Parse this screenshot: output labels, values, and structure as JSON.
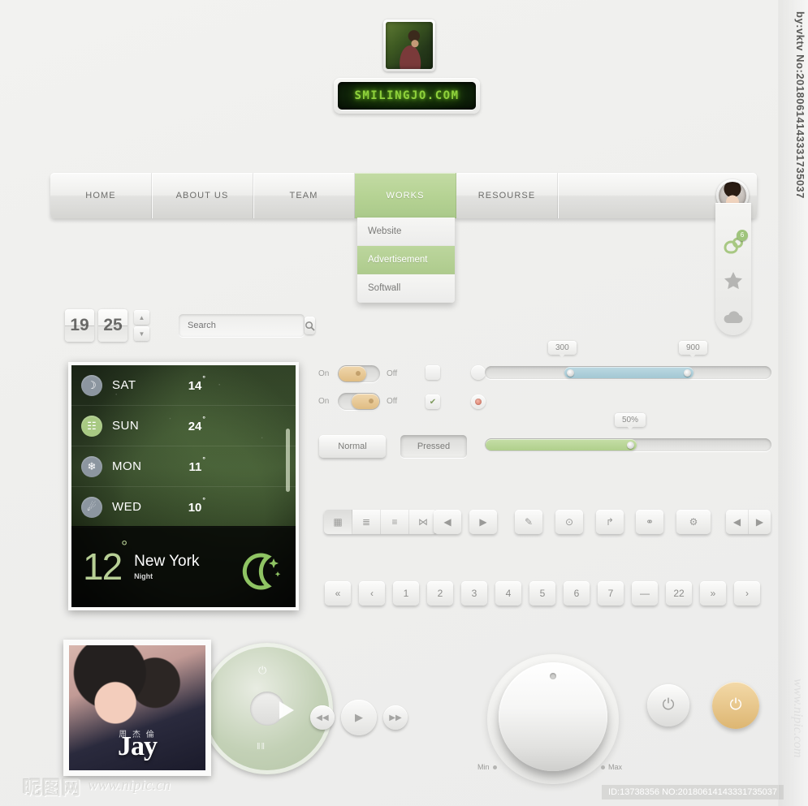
{
  "brand": {
    "led_text": "SMILINGJO.COM"
  },
  "nav": {
    "items": [
      {
        "label": "HOME",
        "active": false
      },
      {
        "label": "ABOUT US",
        "active": false
      },
      {
        "label": "TEAM",
        "active": false
      },
      {
        "label": "WORKS",
        "active": true
      },
      {
        "label": "RESOURSE",
        "active": false
      }
    ],
    "dropdown": [
      {
        "label": "Website",
        "active": false
      },
      {
        "label": "Advertisement",
        "active": true
      },
      {
        "label": "Softwall",
        "active": false
      }
    ]
  },
  "rail": {
    "items": [
      {
        "icon": "users-icon",
        "badge": "6"
      },
      {
        "icon": "star-icon",
        "badge": ""
      },
      {
        "icon": "cloud-icon",
        "badge": ""
      }
    ]
  },
  "counter": {
    "digits": [
      "19",
      "25"
    ],
    "up": "▲",
    "down": "▼"
  },
  "search": {
    "placeholder": "Search",
    "value": "",
    "icon": "search-icon"
  },
  "weather": {
    "forecast": [
      {
        "day": "SAT",
        "temp": "14",
        "unit": "°",
        "icon": "moon-cloud-icon",
        "highlight": false
      },
      {
        "day": "SUN",
        "temp": "24",
        "unit": "°",
        "icon": "rain-icon",
        "highlight": true
      },
      {
        "day": "MON",
        "temp": "11",
        "unit": "°",
        "icon": "snow-icon",
        "highlight": false
      },
      {
        "day": "WED",
        "temp": "10",
        "unit": "°",
        "icon": "sleet-icon",
        "highlight": false
      }
    ],
    "current": {
      "temp": "12",
      "unit": "°",
      "city": "New York",
      "condition": "Night",
      "icon": "moon-stars-icon"
    }
  },
  "toggles": [
    {
      "on_label": "On",
      "off_label": "Off",
      "state": "on"
    },
    {
      "on_label": "On",
      "off_label": "Off",
      "state": "off"
    }
  ],
  "choices": {
    "checkbox_unchecked": "",
    "checkbox_checked": "✔",
    "radio_unselected": "",
    "radio_selected": "●"
  },
  "sliders": [
    {
      "type": "range",
      "min_bubble": "300",
      "max_bubble": "900",
      "fill_color": "#a3c7d3",
      "start_pct": 28,
      "end_pct": 73
    },
    {
      "type": "single",
      "bubble": "50%",
      "fill_color": "#b0cf8c",
      "value_pct": 50
    }
  ],
  "buttons": {
    "normal": "Normal",
    "pressed": "Pressed"
  },
  "icon_buttons": {
    "segmented": [
      "grid-view-icon",
      "list-detail-icon",
      "list-view-icon",
      "columns-icon"
    ],
    "arrows": [
      "arrow-left-icon",
      "arrow-right-icon"
    ],
    "tools": [
      "pencil-icon",
      "location-pin-icon",
      "share-icon",
      "link-icon",
      "gear-icon"
    ],
    "pager_arrows": [
      "arrow-left-icon",
      "arrow-right-icon"
    ],
    "glyphs": {
      "grid-view-icon": "▦",
      "list-detail-icon": "≣",
      "list-view-icon": "≡",
      "columns-icon": "⋈",
      "arrow-left-icon": "◀",
      "arrow-right-icon": "▶",
      "pencil-icon": "✎",
      "location-pin-icon": "⊙",
      "share-icon": "↱",
      "link-icon": "⚭",
      "gear-icon": "⚙"
    }
  },
  "pagination": {
    "first": "«",
    "prev": "‹",
    "pages": [
      "1",
      "2",
      "3",
      "4",
      "5",
      "6",
      "7"
    ],
    "ellipsis": "—",
    "last_page": "22",
    "next": "»",
    "end": "›"
  },
  "player": {
    "album_title": "Jay",
    "album_title_cn": "周 杰 倫",
    "disc_power_icon": "⏻",
    "disc_play_icon": "play-icon",
    "disc_eq_icon": "‖‖",
    "transport": [
      {
        "icon": "rewind-icon",
        "glyph": "◀◀"
      },
      {
        "icon": "play-icon",
        "glyph": "▶"
      },
      {
        "icon": "forward-icon",
        "glyph": "▶▶"
      }
    ]
  },
  "knob": {
    "min_label": "Min",
    "max_label": "Max"
  },
  "power_buttons": [
    {
      "name": "power-button-grey",
      "glyph": "⏻",
      "color": "#dcdcda"
    },
    {
      "name": "power-button-amber",
      "glyph": "⏻",
      "color": "#ddb672"
    }
  ],
  "watermarks": {
    "bottom_left_cn": "昵图网",
    "bottom_left_url": "www.nipic.cn",
    "bottom_right_id": "ID:13738356 NO:20180614143331735037",
    "right_top": "by:vktv No:20180614143331735037",
    "right_bottom": "www.nipic.com"
  }
}
